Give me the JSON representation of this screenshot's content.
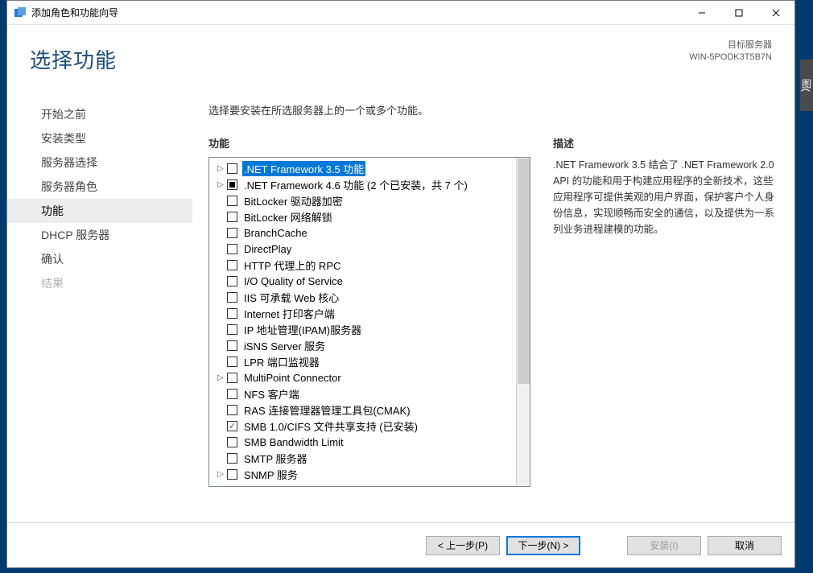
{
  "window": {
    "title": "添加角色和功能向导"
  },
  "header": {
    "page_title": "选择功能",
    "target_label": "目标服务器",
    "target_value": "WIN-5PODK3T5B7N"
  },
  "sidebar": {
    "items": [
      {
        "label": "开始之前",
        "state": "normal"
      },
      {
        "label": "安装类型",
        "state": "normal"
      },
      {
        "label": "服务器选择",
        "state": "normal"
      },
      {
        "label": "服务器角色",
        "state": "normal"
      },
      {
        "label": "功能",
        "state": "active"
      },
      {
        "label": "DHCP 服务器",
        "state": "normal"
      },
      {
        "label": "确认",
        "state": "normal"
      },
      {
        "label": "结果",
        "state": "disabled"
      }
    ]
  },
  "content": {
    "instruction": "选择要安装在所选服务器上的一个或多个功能。",
    "features_label": "功能",
    "description_label": "描述",
    "description_text": ".NET Framework 3.5 结合了 .NET Framework 2.0 API 的功能和用于构建应用程序的全新技术，这些应用程序可提供美观的用户界面，保护客户个人身份信息，实现顺畅而安全的通信，以及提供为一系列业务进程建模的功能。"
  },
  "features": [
    {
      "label": ".NET Framework 3.5 功能",
      "expandable": true,
      "check": "empty",
      "selected": true
    },
    {
      "label": ".NET Framework 4.6 功能 (2 个已安装，共 7 个)",
      "expandable": true,
      "check": "filled"
    },
    {
      "label": "BitLocker 驱动器加密",
      "expandable": false,
      "check": "empty"
    },
    {
      "label": "BitLocker 网络解锁",
      "expandable": false,
      "check": "empty"
    },
    {
      "label": "BranchCache",
      "expandable": false,
      "check": "empty"
    },
    {
      "label": "DirectPlay",
      "expandable": false,
      "check": "empty"
    },
    {
      "label": "HTTP 代理上的 RPC",
      "expandable": false,
      "check": "empty"
    },
    {
      "label": "I/O Quality of Service",
      "expandable": false,
      "check": "empty"
    },
    {
      "label": "IIS 可承载 Web 核心",
      "expandable": false,
      "check": "empty"
    },
    {
      "label": "Internet 打印客户端",
      "expandable": false,
      "check": "empty"
    },
    {
      "label": "IP 地址管理(IPAM)服务器",
      "expandable": false,
      "check": "empty"
    },
    {
      "label": "iSNS Server 服务",
      "expandable": false,
      "check": "empty"
    },
    {
      "label": "LPR 端口监视器",
      "expandable": false,
      "check": "empty"
    },
    {
      "label": "MultiPoint Connector",
      "expandable": true,
      "check": "empty"
    },
    {
      "label": "NFS 客户端",
      "expandable": false,
      "check": "empty"
    },
    {
      "label": "RAS 连接管理器管理工具包(CMAK)",
      "expandable": false,
      "check": "empty"
    },
    {
      "label": "SMB 1.0/CIFS 文件共享支持 (已安装)",
      "expandable": false,
      "check": "checked"
    },
    {
      "label": "SMB Bandwidth Limit",
      "expandable": false,
      "check": "empty"
    },
    {
      "label": "SMTP 服务器",
      "expandable": false,
      "check": "empty"
    },
    {
      "label": "SNMP 服务",
      "expandable": true,
      "check": "empty"
    }
  ],
  "footer": {
    "previous": "< 上一步(P)",
    "next": "下一步(N) >",
    "install": "安装(I)",
    "cancel": "取消"
  },
  "right_strip": "图("
}
